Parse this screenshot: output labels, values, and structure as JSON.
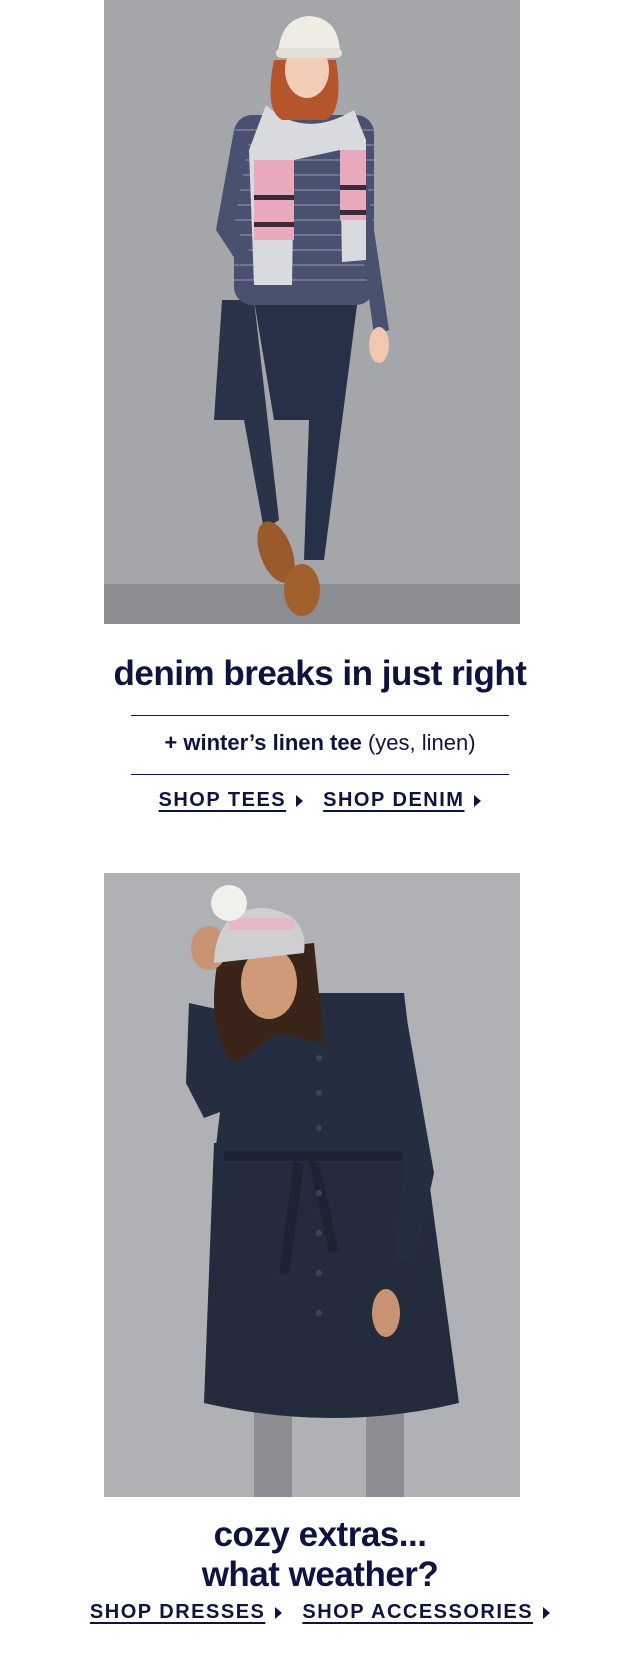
{
  "section1": {
    "image_alt": "Model in striped top, knit scarf, beanie and dark skinny jeans",
    "headline": "denim breaks in just right",
    "subline_bold": "+ winter’s linen tee",
    "subline_regular": " (yes, linen)",
    "ctas": [
      {
        "label": "SHOP TEES"
      },
      {
        "label": "SHOP DENIM"
      }
    ]
  },
  "section2": {
    "image_alt": "Model in dark denim shirt dress with pom beanie and grey tights",
    "headline_line1": "cozy extras...",
    "headline_line2": "what weather?",
    "ctas": [
      {
        "label": "SHOP DRESSES"
      },
      {
        "label": "SHOP ACCESSORIES"
      }
    ]
  },
  "colors": {
    "navy": "#0f1340",
    "photo_bg": "#a2a3a7",
    "denim": "#2a3348"
  }
}
